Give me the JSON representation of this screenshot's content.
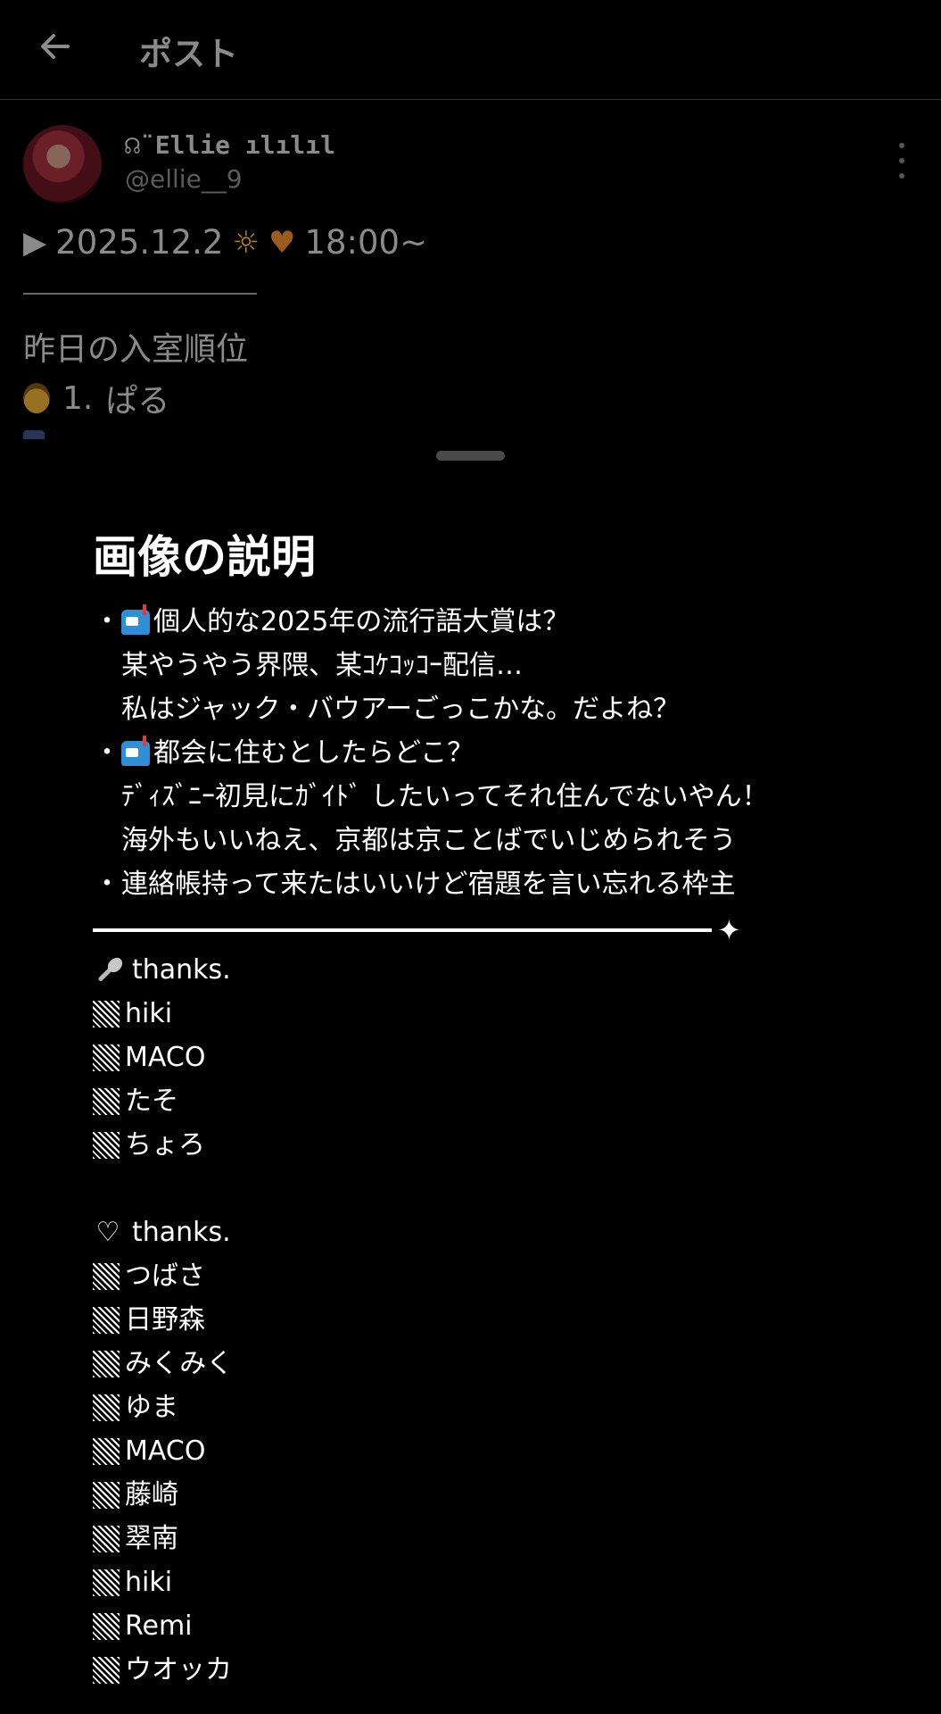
{
  "header": {
    "title": "ポスト",
    "back_icon": "arrow-left-icon"
  },
  "tweet": {
    "display_name": "☊¨Ellie ılılıl",
    "handle": "@ellie__9",
    "line1_date": "2025.12.2",
    "line1_time": "18:00~",
    "line2": "昨日の入室順位",
    "line3_rank": "1.",
    "line3_name": "ぱる"
  },
  "sheet": {
    "title": "画像の説明",
    "lines": [
      {
        "bullet": "・",
        "mailbox": true,
        "text": "個人的な2025年の流行語大賞は？"
      },
      {
        "bullet": "",
        "mailbox": false,
        "text": "某やうやう界隈、某ｺｹｺｯｺｰ配信…"
      },
      {
        "bullet": "",
        "mailbox": false,
        "text": "私はジャック・バウアーごっこかな。だよね？"
      },
      {
        "bullet": "・",
        "mailbox": true,
        "text": "都会に住むとしたらどこ？"
      },
      {
        "bullet": "",
        "mailbox": false,
        "text": "ﾃﾞｨｽﾞﾆｰ初見にｶﾞｲﾄﾞ したいってそれ住んでないやん！"
      },
      {
        "bullet": "",
        "mailbox": false,
        "text": "海外もいいねえ、京都は京ことばでいじめられそう"
      },
      {
        "bullet": "・",
        "mailbox": false,
        "text": "連絡帳持って来たはいいけど宿題を言い忘れる枠主"
      }
    ],
    "sparkle": "✦",
    "spoon_heading": "thanks.",
    "spoon_names": [
      "hiki",
      "MACO",
      "たそ",
      "ちょろ"
    ],
    "heart_symbol": "♡",
    "heart_heading": "thanks.",
    "heart_names": [
      "つばさ",
      "日野森",
      "みくみく",
      "ゆま",
      "MACO",
      "藤崎",
      "翠南",
      "hiki",
      "Remi",
      "ウオッカ"
    ]
  }
}
